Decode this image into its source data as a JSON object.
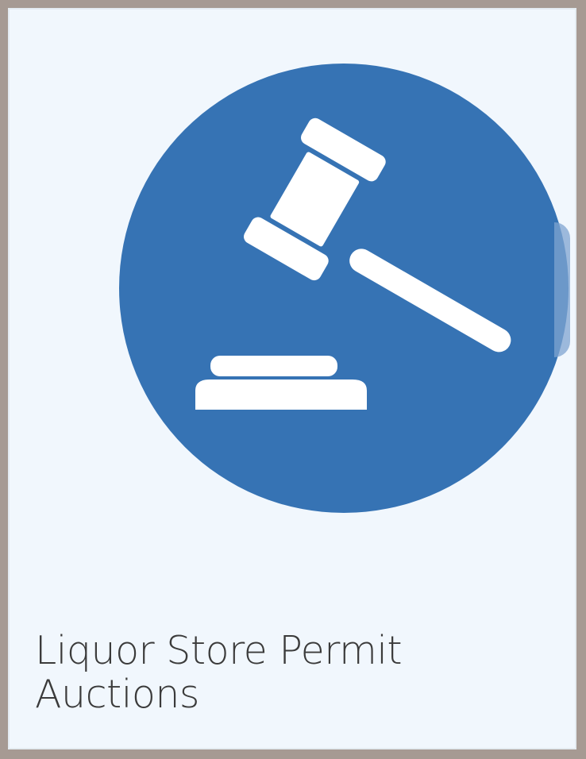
{
  "tile": {
    "title_line1": "Liquor Store Permit",
    "title_line2": "Auctions",
    "icon": "gavel-icon",
    "accent_color": "#3673b4",
    "background_color": "#f1f7fd"
  }
}
